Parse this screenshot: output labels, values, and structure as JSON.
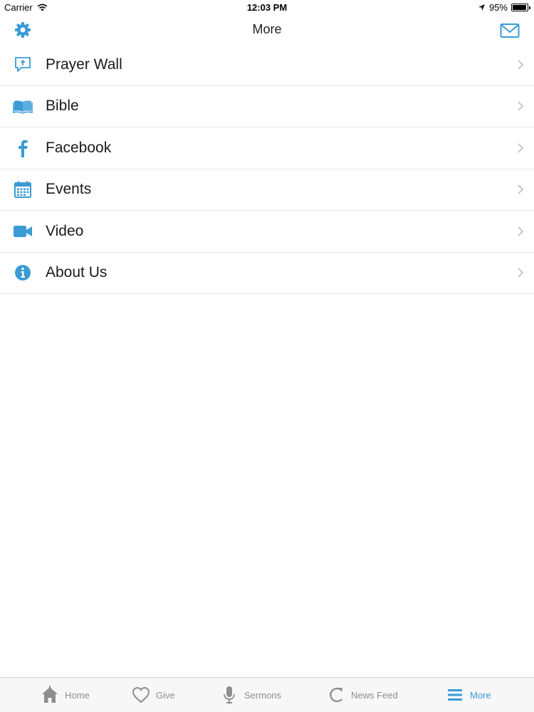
{
  "status_bar": {
    "carrier": "Carrier",
    "time": "12:03 PM",
    "battery": "95%",
    "battery_level": 0.95
  },
  "nav": {
    "title": "More",
    "left_icon": "gear-icon",
    "right_icon": "mail-icon"
  },
  "menu": {
    "items": [
      {
        "label": "Prayer Wall",
        "icon": "prayer-bubble-icon"
      },
      {
        "label": "Bible",
        "icon": "book-icon"
      },
      {
        "label": "Facebook",
        "icon": "facebook-icon"
      },
      {
        "label": "Events",
        "icon": "calendar-icon"
      },
      {
        "label": "Video",
        "icon": "video-camera-icon"
      },
      {
        "label": "About Us",
        "icon": "info-icon"
      }
    ]
  },
  "tabs": [
    {
      "label": "Home",
      "icon": "home-icon",
      "active": false
    },
    {
      "label": "Give",
      "icon": "heart-icon",
      "active": false
    },
    {
      "label": "Sermons",
      "icon": "microphone-icon",
      "active": false
    },
    {
      "label": "News Feed",
      "icon": "refresh-icon",
      "active": false
    },
    {
      "label": "More",
      "icon": "menu-icon",
      "active": true
    }
  ],
  "colors": {
    "accent": "#3a9bd5",
    "inactive": "#8e8e8e",
    "separator": "#e6e6e6"
  }
}
